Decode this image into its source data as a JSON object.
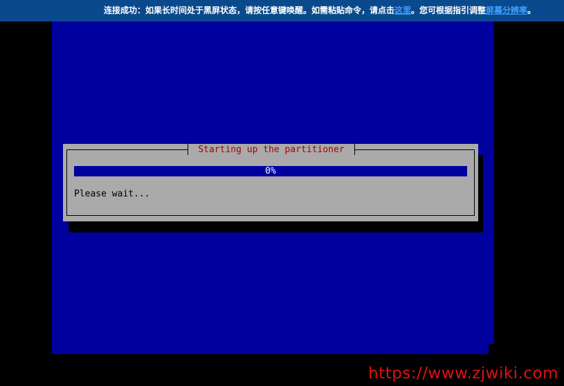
{
  "notice": {
    "text_1": "连接成功：如果长时间处于黑屏状态，请按任意键唤醒。如需粘贴命令，请点击",
    "link_here": "这里",
    "text_2": "。您可根据指引调整",
    "link_resolution": "屏幕分辨率",
    "text_3": "。"
  },
  "installer": {
    "dialog_title": "Starting up the partitioner",
    "progress_percent": 0,
    "progress_label": "0%",
    "status_message": "Please wait..."
  },
  "watermark": {
    "text": "https://www.zjwiki.com"
  },
  "colors": {
    "notice_background": "#0a4a8c",
    "link": "#3fa0ff",
    "screen_background": "#00009f",
    "dialog_background": "#aaaaaa",
    "dialog_title": "#a80000",
    "watermark": "#e01010"
  }
}
